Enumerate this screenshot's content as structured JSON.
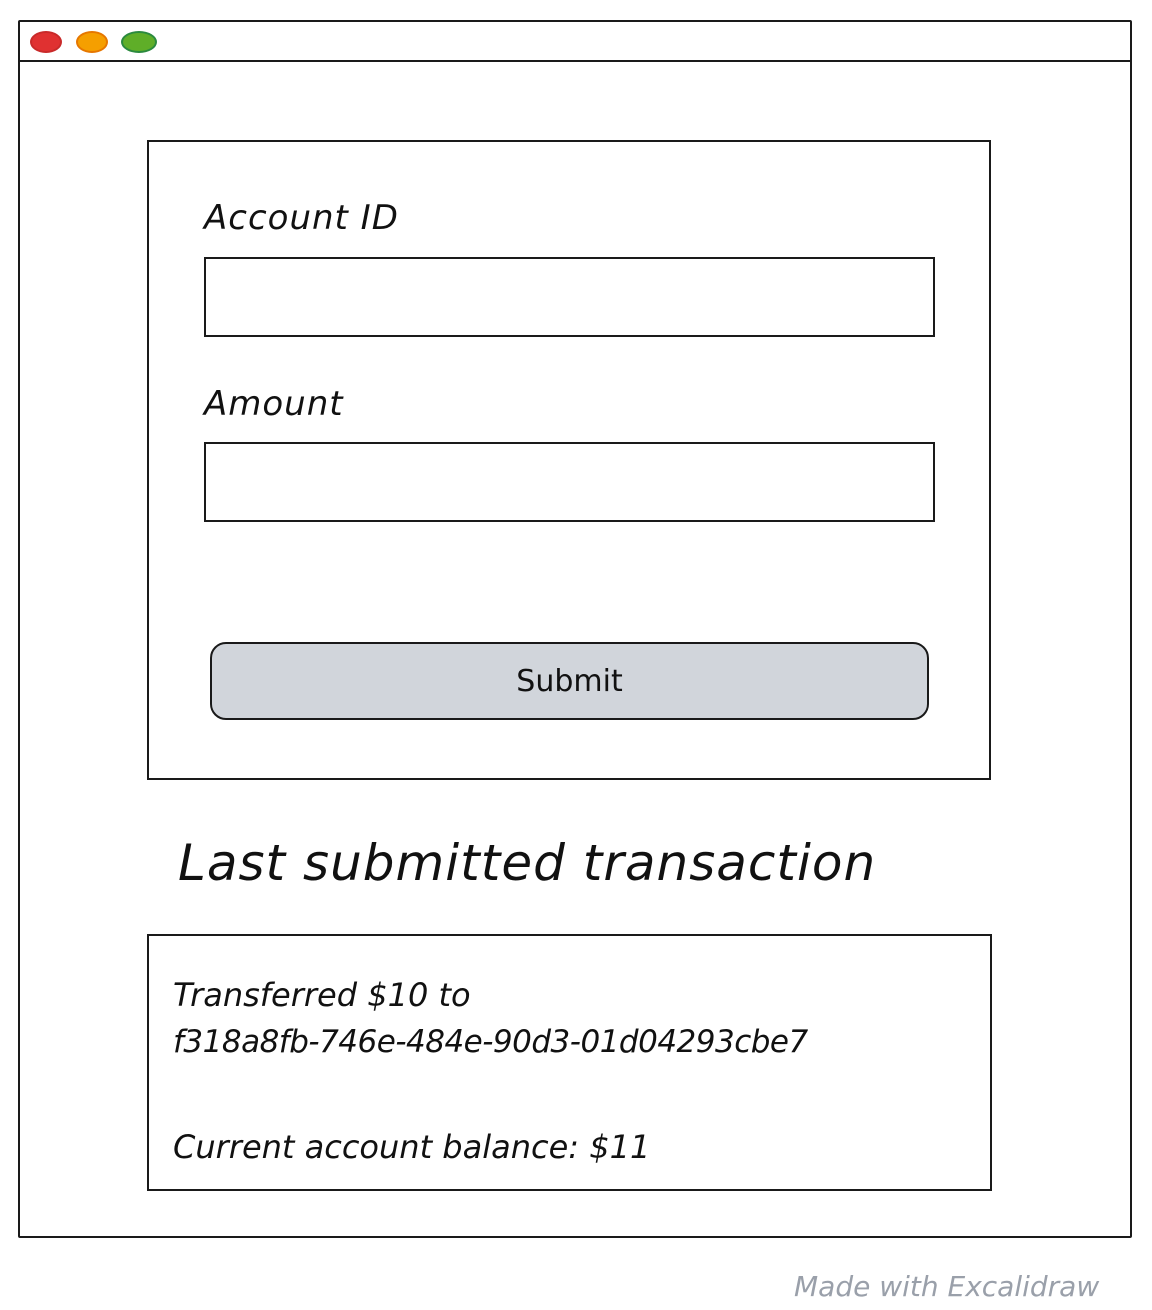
{
  "window": {
    "traffic_lights": [
      {
        "name": "close",
        "fill": "#e03131",
        "stroke": "#c92a2a"
      },
      {
        "name": "minimize",
        "fill": "#f59f00",
        "stroke": "#e67700"
      },
      {
        "name": "zoom",
        "fill": "#5fae28",
        "stroke": "#2b8a3e"
      }
    ]
  },
  "form": {
    "account_label": "Account ID",
    "account_value": "",
    "account_placeholder": "",
    "amount_label": "Amount",
    "amount_value": "",
    "amount_placeholder": "",
    "submit_label": "Submit"
  },
  "result": {
    "heading": "Last submitted transaction",
    "transfer_line": "Transferred $10 to",
    "account_uuid": "f318a8fb-746e-484e-90d3-01d04293cbe7",
    "balance_line": "Current account balance: $11"
  },
  "watermark": "Made with Excalidraw",
  "colors": {
    "button_fill": "#d1d5db",
    "stroke": "#1a1a1a",
    "watermark": "#9aa0aa"
  }
}
